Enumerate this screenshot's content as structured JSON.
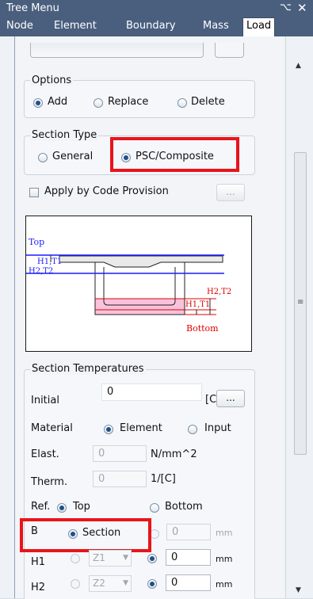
{
  "window": {
    "title": "Tree Menu",
    "pin_glyph": "⌥",
    "close_glyph": "✕"
  },
  "tabs": [
    "Node",
    "Element",
    "Boundary",
    "Mass",
    "Load"
  ],
  "active_tab": "Load",
  "options": {
    "title": "Options",
    "add": "Add",
    "replace": "Replace",
    "delete": "Delete",
    "selected": "Add"
  },
  "section_type": {
    "title": "Section Type",
    "general": "General",
    "psc": "PSC/Composite",
    "selected": "PSC/Composite"
  },
  "apply_code": {
    "label": "Apply by Code Provision",
    "button": "..."
  },
  "diagram": {
    "top": "Top",
    "h1t1_top": "H1,T1",
    "h2t2_top": "H2,T2",
    "h2t2_bottom": "H2,T2",
    "h1t1_bottom": "H1,T1",
    "bottom": "Bottom"
  },
  "temps": {
    "title": "Section Temperatures",
    "initial_label": "Initial",
    "initial_value": "0",
    "initial_unit": "[C]",
    "initial_button": "...",
    "material_label": "Material",
    "material_element": "Element",
    "material_input": "Input",
    "elast_label": "Elast.",
    "elast_value": "0",
    "elast_unit": "N/mm^2",
    "therm_label": "Therm.",
    "therm_value": "0",
    "therm_unit": "1/[C]",
    "ref_label": "Ref.",
    "ref_top": "Top",
    "ref_bottom": "Bottom",
    "b_label": "B",
    "b_section": "Section",
    "b_value": "0",
    "b_unit": "mm",
    "h1_label": "H1",
    "h1_combo": "Z1",
    "h1_value": "0",
    "h1_unit": "mm",
    "h2_label": "H2",
    "h2_combo": "Z2",
    "h2_value": "0",
    "h2_unit": "mm"
  },
  "colors": {
    "highlight": "#e8141a",
    "title_bar": "#4a5f7e",
    "diagram_blue": "#0000cc",
    "diagram_red": "#cc0000"
  }
}
